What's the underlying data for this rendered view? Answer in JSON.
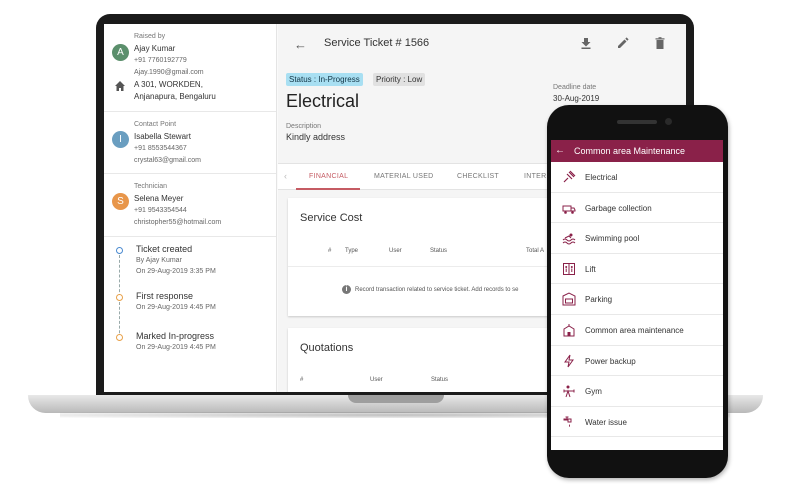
{
  "colors": {
    "accent": "#c55b63",
    "mobile_bar": "#8a2149",
    "status_badge": "#a8dff2"
  },
  "raised_by": {
    "role": "Raised by",
    "initial": "A",
    "avatar_color": "#5b8f6c",
    "name": "Ajay Kumar",
    "phone": "+91 7760192779",
    "email": "Ajay.1990@gmail.com",
    "address_line1": "A 301, WORKDEN,",
    "address_line2": "Anjanapura, Bengaluru",
    "address_icon": "home-icon"
  },
  "contact_point": {
    "role": "Contact Point",
    "initial": "I",
    "avatar_color": "#6a9ec0",
    "name": "Isabella Stewart",
    "phone": "+91 8553544367",
    "email": "crystal63@gmail.com"
  },
  "technician": {
    "role": "Technician",
    "initial": "S",
    "avatar_color": "#e8964a",
    "name": "Selena Meyer",
    "phone": "+91 9543354544",
    "email": "christopher55@hotmail.com"
  },
  "timeline": [
    {
      "title": "Ticket created",
      "by": "By Ajay Kumar",
      "when": "On 29-Aug-2019 3:35 PM"
    },
    {
      "title": "First response",
      "by": "",
      "when": "On 29-Aug-2019 4:45 PM"
    },
    {
      "title": "Marked In-progress",
      "by": "",
      "when": "On 29-Aug-2019 4:45 PM"
    }
  ],
  "ticket": {
    "title": "Service Ticket # 1566",
    "status": "Status : In-Progress",
    "priority": "Priority : Low",
    "category": "Electrical",
    "deadline_label": "Deadline date",
    "deadline_value": "30-Aug-2019",
    "description_label": "Description",
    "description_value": "Kindly address"
  },
  "toolbar_icons": [
    "download-icon",
    "edit-icon",
    "delete-icon"
  ],
  "tabs": [
    "FINANCIAL",
    "MATERIAL USED",
    "CHECKLIST",
    "INTERN"
  ],
  "service_cost": {
    "title": "Service Cost",
    "columns": [
      "#",
      "Type",
      "User",
      "Status",
      "Total A"
    ],
    "empty_message": "Record transaction related to service ticket. Add records to se"
  },
  "quotations": {
    "title": "Quotations",
    "columns": [
      "#",
      "User",
      "Status"
    ]
  },
  "mobile": {
    "title": "Common area Maintenance",
    "items": [
      {
        "label": "Electrical",
        "icon": "electrical-icon"
      },
      {
        "label": "Garbage collection",
        "icon": "garbage-truck-icon"
      },
      {
        "label": "Swimming pool",
        "icon": "swimming-pool-icon"
      },
      {
        "label": "Lift",
        "icon": "lift-icon"
      },
      {
        "label": "Parking",
        "icon": "parking-icon"
      },
      {
        "label": "Common area maintenance",
        "icon": "building-icon"
      },
      {
        "label": "Power backup",
        "icon": "power-backup-icon"
      },
      {
        "label": "Gym",
        "icon": "gym-icon"
      },
      {
        "label": "Water issue",
        "icon": "water-tap-icon"
      }
    ]
  }
}
